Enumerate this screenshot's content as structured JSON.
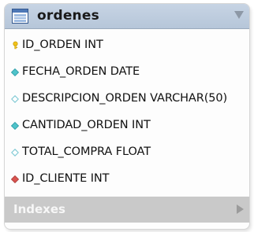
{
  "table": {
    "name": "ordenes",
    "columns": [
      {
        "label": "ID_ORDEN INT",
        "icon": "primary-key-icon"
      },
      {
        "label": "FECHA_ORDEN DATE",
        "icon": "not-null-column-icon"
      },
      {
        "label": "DESCRIPCION_ORDEN VARCHAR(50)",
        "icon": "nullable-column-icon"
      },
      {
        "label": "CANTIDAD_ORDEN INT",
        "icon": "not-null-column-icon"
      },
      {
        "label": "TOTAL_COMPRA FLOAT",
        "icon": "nullable-column-icon"
      },
      {
        "label": "ID_CLIENTE INT",
        "icon": "foreign-key-icon"
      }
    ],
    "indexes_label": "Indexes"
  },
  "colors": {
    "header": "#b6c6d9",
    "key": "#f2c418",
    "not_null": "#4fc3c9",
    "nullable_outline": "#7fc9d4",
    "foreign_key": "#d9534f",
    "indexes_bar": "#c9c9c9"
  }
}
